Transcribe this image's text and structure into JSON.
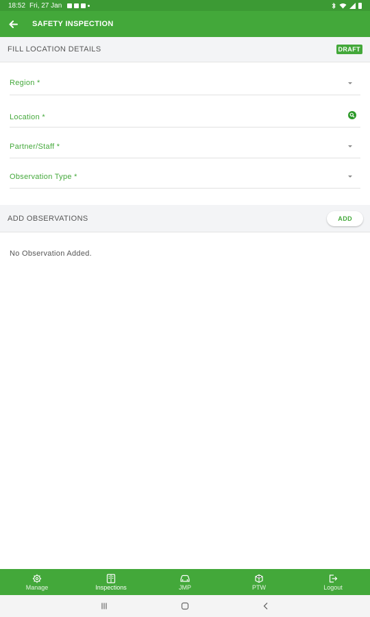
{
  "status_bar": {
    "time": "18:52",
    "date": "Fri, 27 Jan"
  },
  "app_bar": {
    "title": "SAFETY INSPECTION",
    "back_icon": "arrow-left-icon"
  },
  "location_section": {
    "title": "FILL LOCATION DETAILS",
    "badge": "DRAFT"
  },
  "fields": [
    {
      "label": "Region *",
      "trailing_icon": "dropdown-caret-icon"
    },
    {
      "label": "Location *",
      "trailing_icon": "search-icon"
    },
    {
      "label": "Partner/Staff *",
      "trailing_icon": "dropdown-caret-icon"
    },
    {
      "label": "Observation Type *",
      "trailing_icon": "dropdown-caret-icon"
    }
  ],
  "observations_section": {
    "title": "ADD OBSERVATIONS",
    "add_label": "ADD",
    "empty_text": "No Observation Added."
  },
  "bottom_nav": [
    {
      "label": "Manage",
      "icon": "gear-icon",
      "active": false
    },
    {
      "label": "Inspections",
      "icon": "document-icon",
      "active": true
    },
    {
      "label": "JMP",
      "icon": "car-icon",
      "active": false
    },
    {
      "label": "PTW",
      "icon": "permit-icon",
      "active": false
    },
    {
      "label": "Logout",
      "icon": "logout-icon",
      "active": false
    }
  ],
  "colors": {
    "primary": "#43a83a",
    "status_bar": "#3c9a34",
    "section_bg": "#f3f4f6"
  }
}
